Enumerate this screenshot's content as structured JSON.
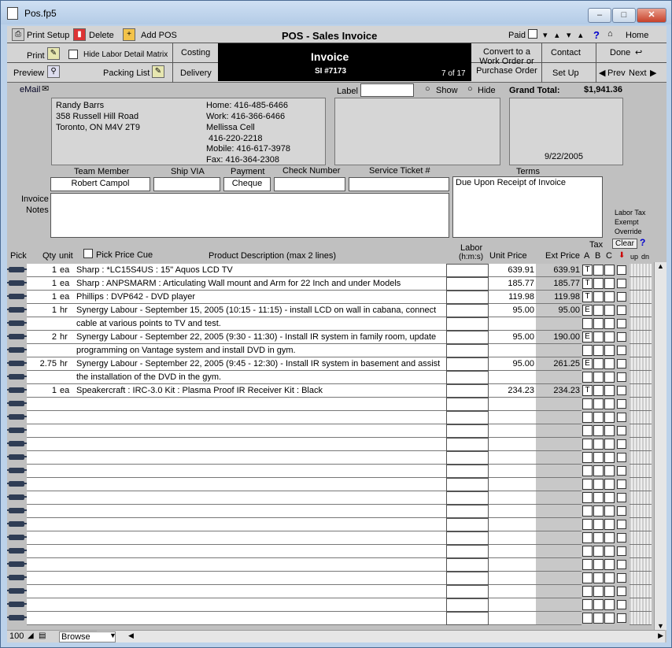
{
  "window": {
    "title": "Pos.fp5",
    "min": "–",
    "max": "□",
    "close": "✕"
  },
  "toolbar": {
    "print_setup": "Print Setup",
    "delete": "Delete",
    "add_pos": "Add POS",
    "form_title": "POS - Sales Invoice",
    "paid": "Paid",
    "help": "?",
    "home": "Home",
    "print": "Print",
    "hide_labor": "Hide Labor Detail Matrix",
    "costing": "Costing",
    "convert": "Convert to a Work Order or Purchase Order",
    "contact": "Contact",
    "done": "Done",
    "preview": "Preview",
    "packing_list": "Packing List",
    "delivery": "Delivery",
    "set_up": "Set Up",
    "prev": "Prev",
    "next": "Next"
  },
  "invoice": {
    "title": "Invoice",
    "number": "SI #7173",
    "record": "7 of 17"
  },
  "customer": {
    "email_label": "eMail",
    "label_label": "Label",
    "show": "Show",
    "hide": "Hide",
    "grand_total_label": "Grand Total:",
    "grand_total": "$1,941.36",
    "name": "Randy Barrs",
    "address1": "358 Russell Hill Road",
    "address2": "Toronto, ON M4V 2T9",
    "home": "Home: 416-485-6466",
    "work": "Work: 416-366-6466",
    "cell_label": "Mellissa Cell",
    "cell": "416-220-2218",
    "mobile": "Mobile: 416-617-3978",
    "fax": "Fax: 416-364-2308",
    "date": "9/22/2005"
  },
  "fields": {
    "team_member_label": "Team Member",
    "team_member": "Robert Campol",
    "ship_via_label": "Ship VIA",
    "ship_via": "",
    "payment_label": "Payment",
    "payment": "Cheque",
    "check_number_label": "Check Number",
    "check_number": "",
    "service_ticket_label": "Service Ticket #",
    "service_ticket": "",
    "terms_label": "Terms",
    "terms": "Due Upon Receipt of Invoice",
    "invoice_notes_label_1": "Invoice",
    "invoice_notes_label_2": "Notes",
    "labor_tax_1": "Labor Tax",
    "labor_tax_2": "Exempt",
    "labor_tax_3": "Override",
    "clear": "Clear"
  },
  "columns": {
    "pick": "Pick",
    "qty": "Qty",
    "unit": "unit",
    "pick_price_cue": "Pick Price Cue",
    "desc": "Product Description (max 2 lines)",
    "labor_1": "Labor",
    "labor_2": "(h:m:s)",
    "unit_price": "Unit Price",
    "ext_price": "Ext Price",
    "tax": "Tax",
    "tax_a": "A",
    "tax_b": "B",
    "tax_c": "C",
    "up": "up",
    "dn": "dn"
  },
  "lines": [
    {
      "qty": "1",
      "unit": "ea",
      "desc": "Sharp : *LC15S4US : 15\" Aquos LCD TV",
      "unit_price": "639.91",
      "ext_price": "639.91",
      "tax": "T"
    },
    {
      "qty": "1",
      "unit": "ea",
      "desc": "Sharp : ANPSMARM  : Articulating Wall mount and Arm for 22 Inch and under Models",
      "unit_price": "185.77",
      "ext_price": "185.77",
      "tax": "T"
    },
    {
      "qty": "1",
      "unit": "ea",
      "desc": "Phillips : DVP642 - DVD player",
      "unit_price": "119.98",
      "ext_price": "119.98",
      "tax": "T"
    },
    {
      "qty": "1",
      "unit": "hr",
      "desc": "Synergy Labour - September 15, 2005 (10:15 - 11:15) - install LCD on wall in cabana, connect",
      "unit_price": "95.00",
      "ext_price": "95.00",
      "tax": "E"
    },
    {
      "qty": "",
      "unit": "",
      "desc": "cable at various points to TV and test.",
      "unit_price": "",
      "ext_price": "",
      "tax": ""
    },
    {
      "qty": "2",
      "unit": "hr",
      "desc": "Synergy Labour - September 22, 2005 (9:30 - 11:30) - Install IR system in family room, update",
      "unit_price": "95.00",
      "ext_price": "190.00",
      "tax": "E"
    },
    {
      "qty": "",
      "unit": "",
      "desc": "programming on Vantage system and install DVD in gym.",
      "unit_price": "",
      "ext_price": "",
      "tax": ""
    },
    {
      "qty": "2.75",
      "unit": "hr",
      "desc": "Synergy Labour - September 22, 2005 (9:45 - 12:30) - Install IR system in basement and assist",
      "unit_price": "95.00",
      "ext_price": "261.25",
      "tax": "E"
    },
    {
      "qty": "",
      "unit": "",
      "desc": "the installation of the DVD in the gym.",
      "unit_price": "",
      "ext_price": "",
      "tax": ""
    },
    {
      "qty": "1",
      "unit": "ea",
      "desc": "Speakercraft : IRC-3.0 Kit : Plasma Proof IR Receiver Kit : Black",
      "unit_price": "234.23",
      "ext_price": "234.23",
      "tax": "T"
    }
  ],
  "status": {
    "zoom": "100",
    "mode": "Browse"
  }
}
